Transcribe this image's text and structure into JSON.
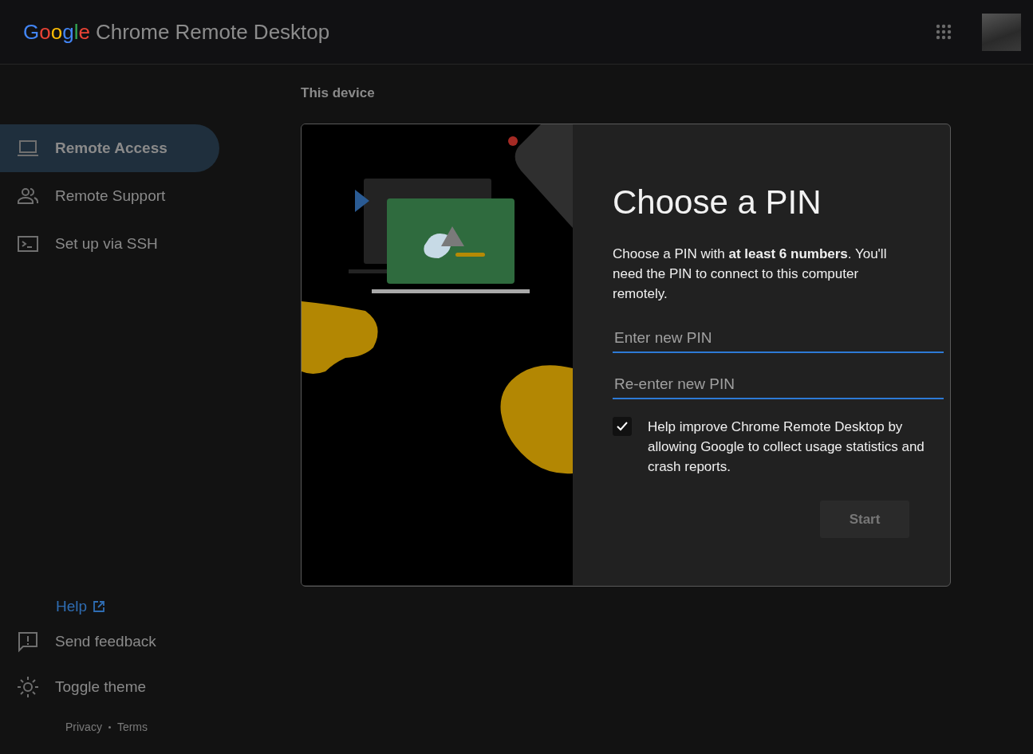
{
  "header": {
    "logo": "Google",
    "product": "Chrome Remote Desktop"
  },
  "sidebar": {
    "items": [
      {
        "label": "Remote Access",
        "kind": "laptop",
        "selected": true
      },
      {
        "label": "Remote Support",
        "kind": "people",
        "selected": false
      },
      {
        "label": "Set up via SSH",
        "kind": "terminal",
        "selected": false
      }
    ],
    "help": "Help",
    "bottom_items": [
      {
        "label": "Send feedback",
        "kind": "feedback"
      },
      {
        "label": "Toggle theme",
        "kind": "sun"
      }
    ],
    "footer_links": [
      "Privacy",
      "Terms"
    ]
  },
  "section_title": "This device",
  "dialog": {
    "title": "Choose a PIN",
    "description": "Choose a PIN with **at least 6 numbers**. You'll need the PIN to connect to this computer remotely.",
    "fields": [
      {
        "placeholder": "Enter new PIN"
      },
      {
        "placeholder": "Re-enter new PIN"
      }
    ],
    "consent": {
      "label": "Help improve Chrome Remote Desktop by allowing Google to collect usage statistics and crash reports.",
      "checked": true
    },
    "start_button": {
      "label": "Start",
      "disabled": true
    }
  }
}
